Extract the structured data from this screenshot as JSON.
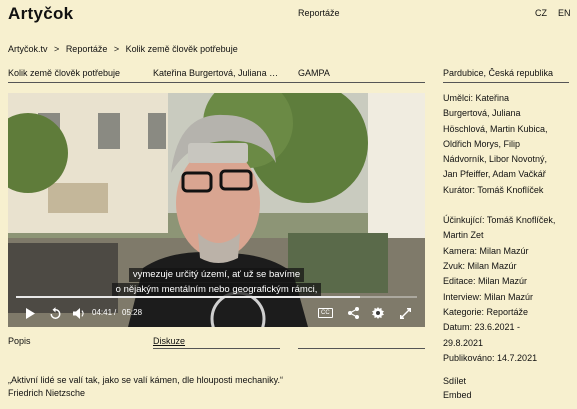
{
  "header": {
    "logo": "Artyčok",
    "nav_item": "Reportáže",
    "lang_cz": "CZ",
    "lang_en": "EN"
  },
  "breadcrumb": [
    "Artyčok.tv",
    ">",
    "Reportáže",
    ">",
    "Kolik země člověk potřebuje"
  ],
  "info": {
    "title": "Kolik země člověk potřebuje",
    "authors": "Kateřina Burgertová, Juliana Höschlová",
    "place": "GAMPA",
    "city": "Pardubice, Česká republika"
  },
  "video": {
    "subtitle_line1": "vymezuje určitý území, ať už se bavíme",
    "subtitle_line2": "o nějakým mentálním nebo geografickým rámci,",
    "current_time": "04:41",
    "separator": "/",
    "total_time": "05:28",
    "progress": 0.857,
    "cc_label": "CC"
  },
  "sidebar": {
    "artists_lines": [
      "Umělci: Kateřina",
      "Burgertová, Juliana",
      "Höschlová, Martin Kubica,",
      "Oldřich Morys, Filip",
      "Nádvorník, Libor Novotný,",
      "Jan Pfeiffer, Adam Vačkář",
      "Kurátor: Tomáš Knoflíček"
    ],
    "crew_lines": [
      "Účinkující: Tomáš Knoflíček,",
      "Martin Zet",
      "Kamera: Milan Mazúr",
      "Zvuk: Milan Mazúr",
      "Editace: Milan Mazúr",
      "Interview: Milan Mazúr"
    ],
    "meta_lines": [
      "Kategorie: Reportáže",
      "Datum: 23.6.2021 -",
      "29.8.2021",
      "Publikováno: 14.7.2021"
    ]
  },
  "tabs": {
    "popis": "Popis",
    "diskuze": "Diskuze"
  },
  "quote": {
    "text": "„Aktivní lidé se valí tak, jako se valí kámen, dle hlouposti mechaniky.“",
    "author": "Friedrich Nietzsche"
  },
  "actions": {
    "share": "Sdílet",
    "embed": "Embed"
  }
}
